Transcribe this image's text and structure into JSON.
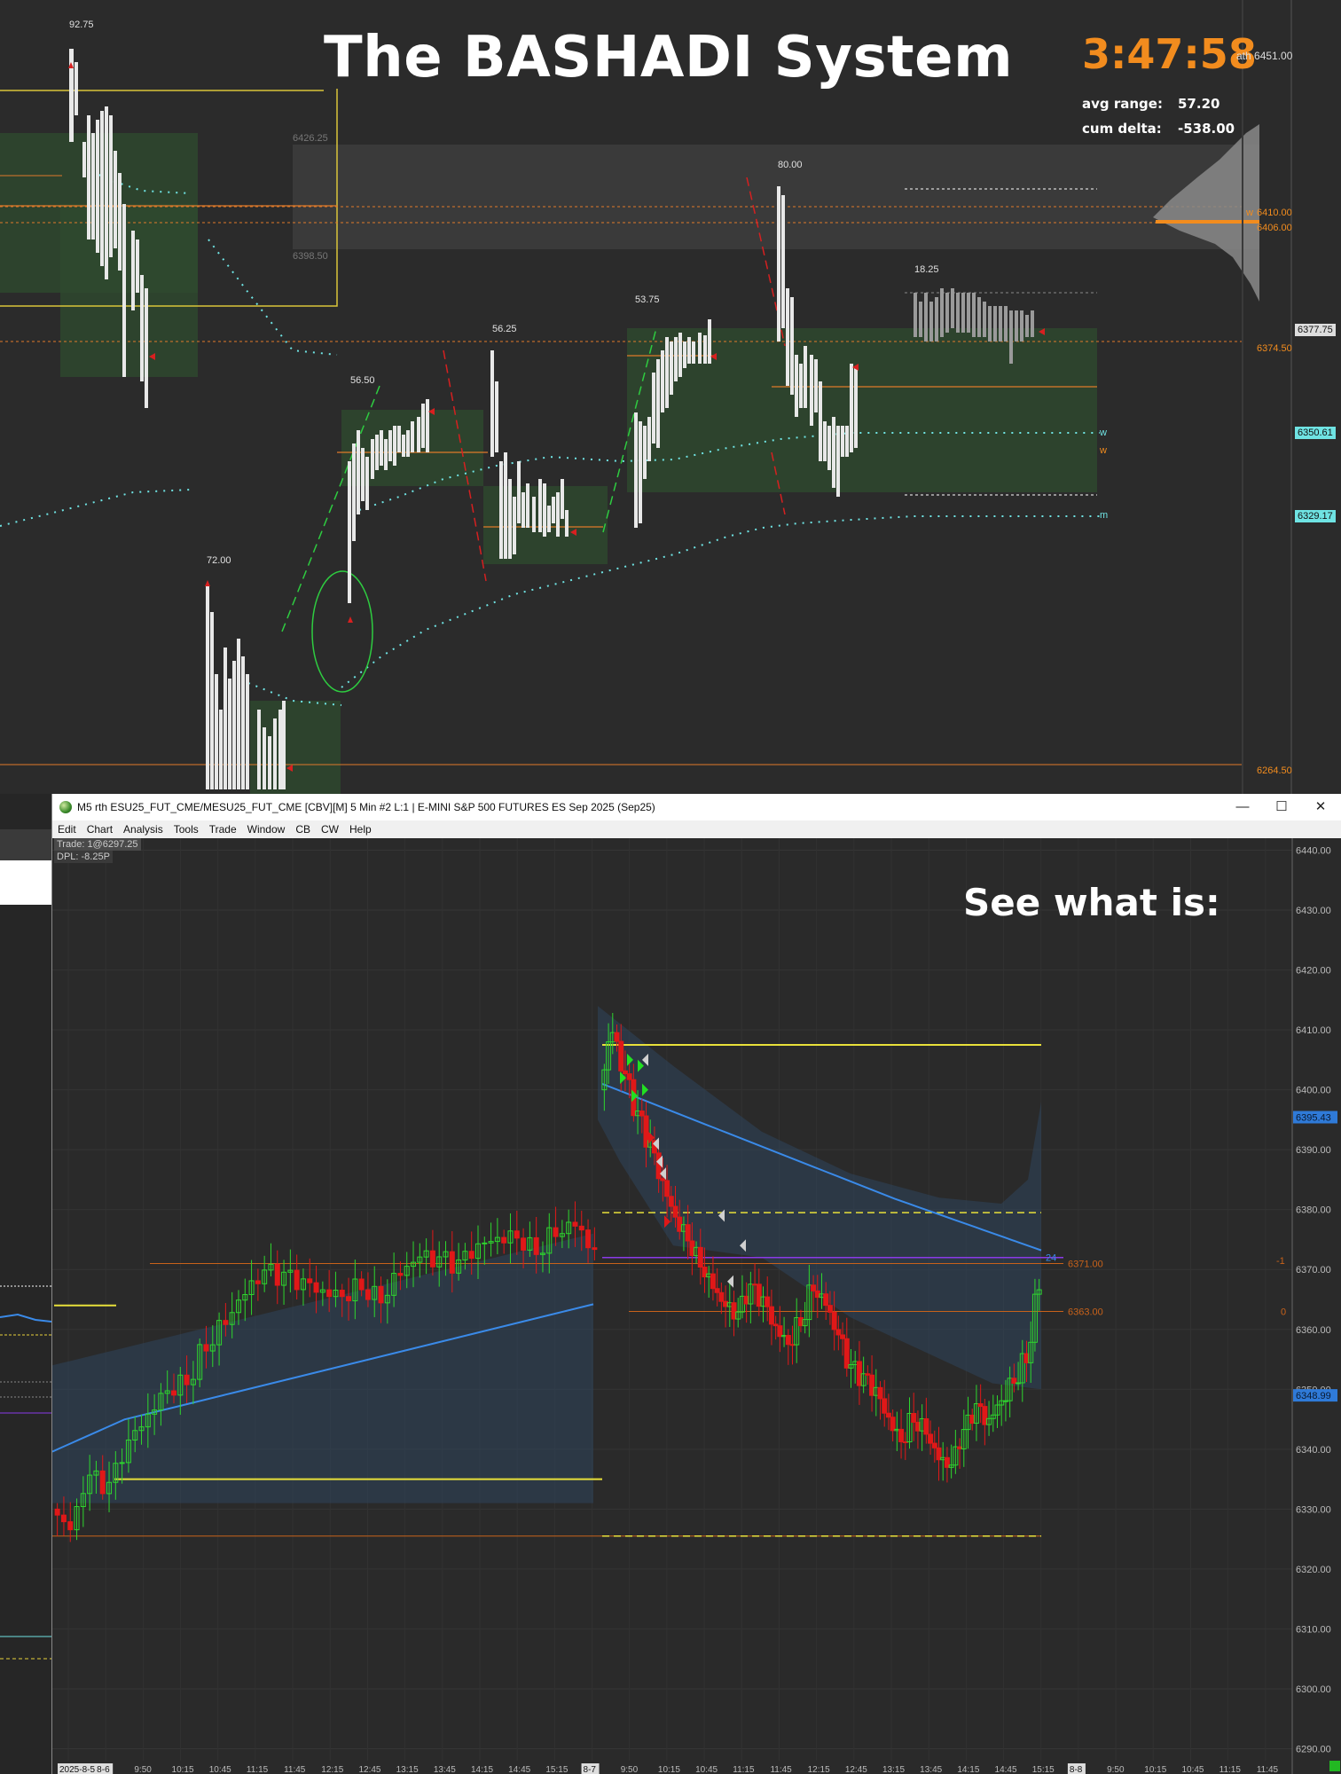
{
  "header": {
    "brand_title": "The BASHADI System",
    "clock": "3:47:58",
    "ath_label": "ath",
    "ath_value": "6451.00",
    "avg_range_label": "avg range:",
    "avg_range_value": "57.20",
    "cum_delta_label": "cum delta:",
    "cum_delta_value": "-538.00"
  },
  "profile_chart": {
    "profile_labels": [
      "92.75",
      "56.50",
      "56.25",
      "53.75",
      "80.00",
      "18.25",
      "72.00"
    ],
    "price_levels": [
      "6426.25",
      "6398.50"
    ],
    "right_tags": [
      "6410.00",
      "6406.00",
      "6377.75",
      "6374.50",
      "6350.61",
      "6329.17",
      "6264.50"
    ],
    "band_markers": [
      "w",
      "w",
      "m"
    ],
    "colors": {
      "orange": "#f28c1e",
      "yellow": "#e8d23a",
      "cyan": "#6fe3e3",
      "green_box": "#2f4a2f"
    }
  },
  "window": {
    "title": "M5 rth ESU25_FUT_CME/MESU25_FUT_CME [CBV][M]  5 Min  #2 L:1 | E-MINI S&P 500 FUTURES ES Sep 2025 (Sep25)",
    "minimize": "—",
    "maximize": "☐",
    "close": "✕",
    "menu": [
      "Edit",
      "Chart",
      "Analysis",
      "Tools",
      "Trade",
      "Window",
      "CB",
      "CW",
      "Help"
    ],
    "trade_info": "Trade: 1@6297.25",
    "dpl_info": "DPL: -8.25P",
    "overlay_text": "See what is:"
  },
  "chart_data": {
    "type": "candlestick",
    "instrument": "E-MINI S&P 500 FUTURES ES Sep 2025 (Sep25)",
    "timeframe": "5 Min",
    "y_axis_ticks": [
      "6440.00",
      "6430.00",
      "6420.00",
      "6410.00",
      "6400.00",
      "6390.00",
      "6380.00",
      "6370.00",
      "6360.00",
      "6350.00",
      "6340.00",
      "6330.00",
      "6320.00",
      "6310.00",
      "6300.00",
      "6290.00"
    ],
    "ylim": [
      6288,
      6442
    ],
    "x_axis_ticks": [
      "2025-8-5",
      "8-6",
      "9:50",
      "10:15",
      "10:45",
      "11:15",
      "11:45",
      "12:15",
      "12:45",
      "13:15",
      "13:45",
      "14:15",
      "14:45",
      "15:15",
      "8-7",
      "9:50",
      "10:15",
      "10:45",
      "11:15",
      "11:45",
      "12:15",
      "12:45",
      "13:15",
      "13:45",
      "14:15",
      "14:45",
      "15:15",
      "8-8",
      "9:50",
      "10:15",
      "10:45",
      "11:15",
      "11:45"
    ],
    "right_price_tags": [
      "6395.43",
      "6348.99"
    ],
    "level_labels": [
      "6371.00",
      "6363.00"
    ],
    "blue_line_label": "24",
    "side_marks": [
      "-1",
      "0"
    ],
    "horizontal_levels": [
      6407.5,
      6379.5,
      6372.0,
      6371.0,
      6363.0,
      6325.5
    ],
    "day2_close_path": [
      6327,
      6335,
      6333,
      6340,
      6345,
      6350,
      6352,
      6358,
      6362,
      6366,
      6369,
      6368,
      6367,
      6366,
      6366,
      6368,
      6366,
      6370,
      6372,
      6371,
      6370,
      6373,
      6375,
      6376,
      6374,
      6377,
      6378,
      6373
    ],
    "day3_close_path": [
      6410,
      6402,
      6395,
      6390,
      6384,
      6379,
      6376,
      6372,
      6368,
      6364,
      6362,
      6366,
      6364,
      6360,
      6358,
      6362,
      6368,
      6365,
      6359,
      6353,
      6351,
      6349,
      6345,
      6342,
      6346,
      6344,
      6339,
      6337,
      6342,
      6346,
      6344,
      6348,
      6352,
      6356,
      6368
    ]
  }
}
